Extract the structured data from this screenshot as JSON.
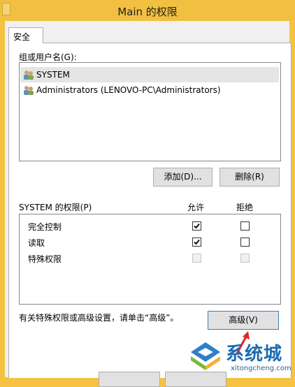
{
  "window": {
    "title": "Main 的权限"
  },
  "tabs": [
    {
      "label": "安全"
    }
  ],
  "users": {
    "label": "组或用户名(G):",
    "items": [
      {
        "name": "SYSTEM",
        "selected": true
      },
      {
        "name": "Administrators (LENOVO-PC\\Administrators)",
        "selected": false
      }
    ]
  },
  "buttons": {
    "add": "添加(D)...",
    "remove": "删除(R)",
    "advanced": "高级(V)"
  },
  "permissions": {
    "title": "SYSTEM 的权限(P)",
    "allow_header": "允许",
    "deny_header": "拒绝",
    "rows": [
      {
        "name": "完全控制",
        "allow": true,
        "deny": false,
        "enabled": true
      },
      {
        "name": "读取",
        "allow": true,
        "deny": false,
        "enabled": true
      },
      {
        "name": "特殊权限",
        "allow": false,
        "deny": false,
        "enabled": false
      }
    ]
  },
  "advanced_hint": "有关特殊权限或高级设置，请单击“高级”。",
  "watermark": {
    "brand": "系统城",
    "url": "xitongcheng.com"
  }
}
